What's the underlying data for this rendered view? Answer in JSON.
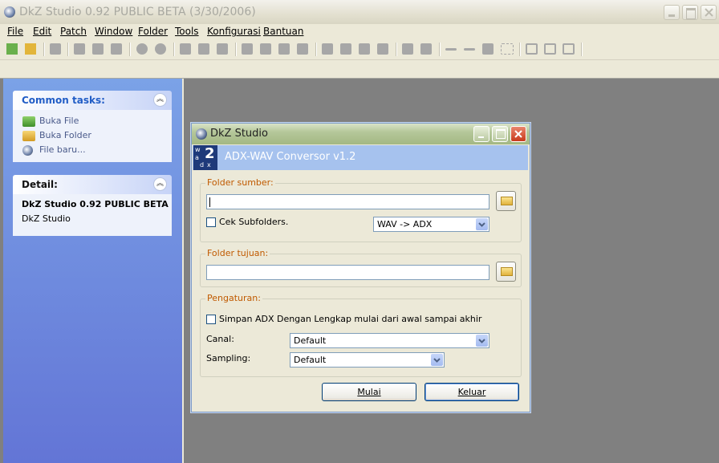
{
  "app": {
    "title": "DkZ Studio 0.92 PUBLIC BETA (3/30/2006)",
    "icon": "app-icon"
  },
  "menu": [
    "File",
    "Edit",
    "Patch",
    "Window",
    "Folder",
    "Tools",
    "Konfigurasi",
    "Bantuan"
  ],
  "task_pane": {
    "common_tasks": {
      "title": "Common tasks:",
      "items": [
        {
          "label": "Buka File",
          "icon": "open-file-icon"
        },
        {
          "label": "Buka Folder",
          "icon": "open-folder-icon"
        },
        {
          "label": "File baru...",
          "icon": "new-file-icon"
        }
      ]
    },
    "detail": {
      "title": "Detail:",
      "name": "DkZ Studio 0.92 PUBLIC BETA",
      "subtitle": "DkZ Studio"
    }
  },
  "dialog": {
    "title": "DkZ Studio",
    "header_title": "ADX-WAV Conversor v1.2",
    "logo_number": "2",
    "logo_letters": [
      "w",
      "a",
      "d",
      "x"
    ],
    "source": {
      "legend": "Folder sumber:",
      "path_value": "",
      "subfolders_label": "Cek Subfolders.",
      "subfolders_checked": false,
      "mode_value": "WAV -> ADX"
    },
    "dest": {
      "legend": "Folder tujuan:",
      "path_value": ""
    },
    "settings": {
      "legend": "Pengaturan:",
      "save_full_label": "Simpan ADX Dengan Lengkap mulai dari awal sampai akhir",
      "save_full_checked": false,
      "canal_label": "Canal:",
      "canal_value": "Default",
      "sampling_label": "Sampling:",
      "sampling_value": "Default"
    },
    "buttons": {
      "start": "Mulai",
      "exit": "Keluar"
    }
  },
  "colors": {
    "task_pane_top": "#7ba2e7",
    "task_pane_bottom": "#6375d6",
    "workspace": "#808080",
    "dialog_header": "#a6c2ee",
    "legend_text": "#c05a00",
    "close_button": "#d9462c"
  }
}
